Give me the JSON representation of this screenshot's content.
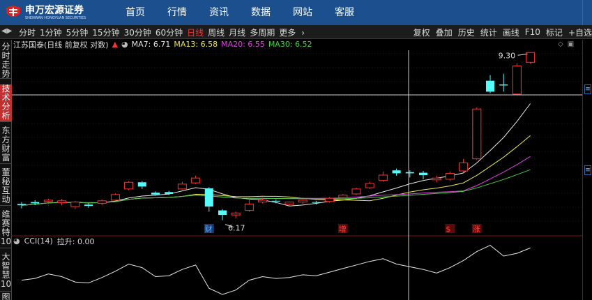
{
  "header": {
    "logo_cn": "申万宏源证券",
    "logo_en": "SHENWAN HONGYUAN SECURITIES",
    "nav": [
      "首页",
      "行情",
      "资讯",
      "数据",
      "网站",
      "客服"
    ]
  },
  "toolbar": {
    "periods": [
      "分时",
      "1分钟",
      "5分钟",
      "15分钟",
      "30分钟",
      "60分钟",
      "日线",
      "周线",
      "月线",
      "多周期",
      "更多"
    ],
    "active_period": "日线",
    "more_arrow": "›",
    "tools": [
      "复权",
      "叠加",
      "历史",
      "统计",
      "画线",
      "F10",
      "标记",
      "+自选"
    ]
  },
  "sidebar": {
    "tabs": [
      "分时走势",
      "技术分析",
      "东方财富",
      "董秘互动",
      "维赛特10",
      "大智慧10",
      "图"
    ],
    "active_tab": "技术分析"
  },
  "legend": {
    "stock": "江苏国泰(日线 前复权 对数)",
    "items": [
      {
        "label": "MA7: 6.71",
        "color": "#e8e8e8"
      },
      {
        "label": "MA13: 6.58",
        "color": "#e8e84a"
      },
      {
        "label": "MA20: 6.55",
        "color": "#e040e0"
      },
      {
        "label": "MA30: 6.52",
        "color": "#40d040"
      }
    ]
  },
  "indicator": {
    "name": "CCI(14)",
    "value": "拉升: 0.00"
  },
  "chart_data": {
    "type": "candlestick",
    "high_label": "9.30",
    "low_label": "6.17",
    "markers": [
      {
        "text": "财",
        "index": 14
      },
      {
        "text": "增",
        "index": 24
      },
      {
        "text": "$",
        "index": 32
      },
      {
        "text": "涨",
        "index": 34
      }
    ],
    "candles": [
      {
        "o": 6.42,
        "c": 6.4,
        "h": 6.45,
        "l": 6.35
      },
      {
        "o": 6.45,
        "c": 6.43,
        "h": 6.48,
        "l": 6.4
      },
      {
        "o": 6.46,
        "c": 6.48,
        "h": 6.5,
        "l": 6.42
      },
      {
        "o": 6.44,
        "c": 6.47,
        "h": 6.5,
        "l": 6.4
      },
      {
        "o": 6.38,
        "c": 6.45,
        "h": 6.47,
        "l": 6.34
      },
      {
        "o": 6.41,
        "c": 6.39,
        "h": 6.43,
        "l": 6.36
      },
      {
        "o": 6.43,
        "c": 6.47,
        "h": 6.49,
        "l": 6.4
      },
      {
        "o": 6.48,
        "c": 6.57,
        "h": 6.59,
        "l": 6.47
      },
      {
        "o": 6.66,
        "c": 6.77,
        "h": 6.79,
        "l": 6.64
      },
      {
        "o": 6.77,
        "c": 6.7,
        "h": 6.79,
        "l": 6.66
      },
      {
        "o": 6.6,
        "c": 6.57,
        "h": 6.62,
        "l": 6.55
      },
      {
        "o": 6.61,
        "c": 6.58,
        "h": 6.63,
        "l": 6.56
      },
      {
        "o": 6.66,
        "c": 6.74,
        "h": 6.78,
        "l": 6.65
      },
      {
        "o": 6.76,
        "c": 6.84,
        "h": 6.88,
        "l": 6.74
      },
      {
        "o": 6.67,
        "c": 6.38,
        "h": 6.69,
        "l": 6.3
      },
      {
        "o": 6.32,
        "c": 6.25,
        "h": 6.34,
        "l": 6.17
      },
      {
        "o": 6.25,
        "c": 6.28,
        "h": 6.3,
        "l": 6.2
      },
      {
        "o": 6.32,
        "c": 6.42,
        "h": 6.52,
        "l": 6.3
      },
      {
        "o": 6.45,
        "c": 6.48,
        "h": 6.52,
        "l": 6.43
      },
      {
        "o": 6.47,
        "c": 6.46,
        "h": 6.49,
        "l": 6.43
      },
      {
        "o": 6.42,
        "c": 6.45,
        "h": 6.46,
        "l": 6.39
      },
      {
        "o": 6.45,
        "c": 6.48,
        "h": 6.49,
        "l": 6.42
      },
      {
        "o": 6.45,
        "c": 6.44,
        "h": 6.47,
        "l": 6.41
      },
      {
        "o": 6.46,
        "c": 6.51,
        "h": 6.53,
        "l": 6.44
      },
      {
        "o": 6.52,
        "c": 6.56,
        "h": 6.58,
        "l": 6.5
      },
      {
        "o": 6.58,
        "c": 6.66,
        "h": 6.68,
        "l": 6.56
      },
      {
        "o": 6.68,
        "c": 6.75,
        "h": 6.78,
        "l": 6.66
      },
      {
        "o": 6.8,
        "c": 6.89,
        "h": 6.95,
        "l": 6.78
      },
      {
        "o": 6.97,
        "c": 6.92,
        "h": 7.0,
        "l": 6.88
      },
      {
        "o": 6.94,
        "c": 6.92,
        "h": 6.97,
        "l": 6.85
      },
      {
        "o": 6.93,
        "c": 6.89,
        "h": 6.96,
        "l": 6.82
      },
      {
        "o": 6.81,
        "c": 6.84,
        "h": 6.88,
        "l": 6.77
      },
      {
        "o": 6.82,
        "c": 6.92,
        "h": 6.95,
        "l": 6.79
      },
      {
        "o": 6.96,
        "c": 7.1,
        "h": 7.17,
        "l": 6.93
      },
      {
        "o": 7.17,
        "c": 8.1,
        "h": 8.13,
        "l": 7.15
      },
      {
        "o": 8.68,
        "c": 8.45,
        "h": 8.8,
        "l": 8.42
      },
      {
        "o": 8.6,
        "c": 8.58,
        "h": 8.83,
        "l": 8.45
      },
      {
        "o": 8.4,
        "c": 9.0,
        "h": 9.06,
        "l": 8.38
      },
      {
        "o": 9.08,
        "c": 9.3,
        "h": 9.3,
        "l": 9.05
      }
    ],
    "cci": [
      -60,
      -40,
      10,
      -20,
      -80,
      -90,
      -30,
      40,
      120,
      80,
      -20,
      -10,
      60,
      110,
      -150,
      -220,
      -170,
      -60,
      -20,
      -40,
      -30,
      0,
      -10,
      30,
      70,
      110,
      150,
      180,
      120,
      90,
      60,
      20,
      80,
      160,
      260,
      330,
      210,
      240,
      300
    ]
  }
}
